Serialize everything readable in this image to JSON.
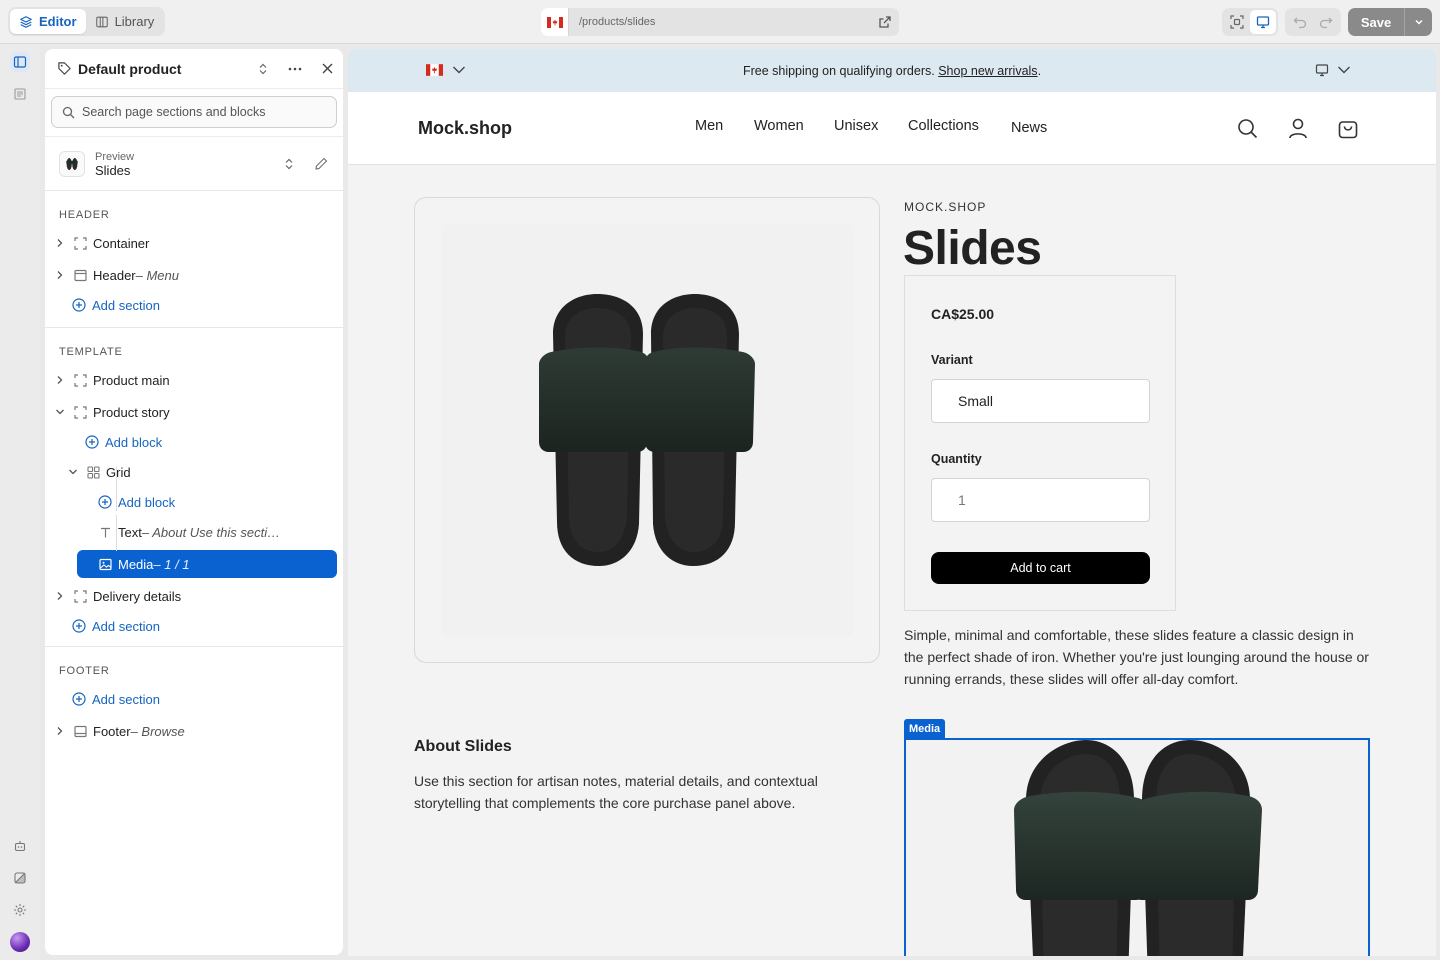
{
  "topbar": {
    "editor_label": "Editor",
    "library_label": "Library",
    "url": "/products/slides",
    "save_label": "Save"
  },
  "sidebar": {
    "template_title": "Default product",
    "search_placeholder": "Search page sections and blocks",
    "preview_label": "Preview",
    "preview_value": "Slides",
    "header_group": "HEADER",
    "template_group": "TEMPLATE",
    "footer_group": "FOOTER",
    "header_items": [
      {
        "label": "Container",
        "sub": ""
      },
      {
        "label": "Header",
        "sub": " – Menu"
      }
    ],
    "add_section": "Add section",
    "add_block": "Add block",
    "template_items": {
      "product_main": "Product main",
      "product_story": "Product story",
      "grid": "Grid",
      "text_label": "Text",
      "text_sub": " – About Use this secti…",
      "media_label": "Media",
      "media_sub": " – 1 / 1",
      "delivery": "Delivery details"
    },
    "footer_item": {
      "label": "Footer",
      "sub": " – Browse"
    }
  },
  "store": {
    "announcement_text": "Free shipping on qualifying orders. ",
    "announcement_link": "Shop new arrivals",
    "announcement_end": ".",
    "logo": "Mock.shop",
    "nav": [
      "Men",
      "Women",
      "Unisex",
      "Collections",
      "News"
    ]
  },
  "product": {
    "vendor": "MOCK.SHOP",
    "title": "Slides",
    "price": "CA$25.00",
    "variant_label": "Variant",
    "variant_value": "Small",
    "quantity_label": "Quantity",
    "quantity_value": "1",
    "add_to_cart": "Add to cart",
    "description": "Simple, minimal and comfortable, these slides feature a classic design in the perfect shade of iron. Whether you're just lounging around the house or running errands, these slides will offer all-day comfort."
  },
  "story": {
    "heading": "About Slides",
    "body": "Use this section for artisan notes, material details, and contextual storytelling that complements the core purchase panel above.",
    "media_tag": "Media"
  },
  "colors": {
    "accent": "#0a62d0",
    "announcement_bg": "#dde9f1",
    "save_bg": "#8a8a8a"
  }
}
